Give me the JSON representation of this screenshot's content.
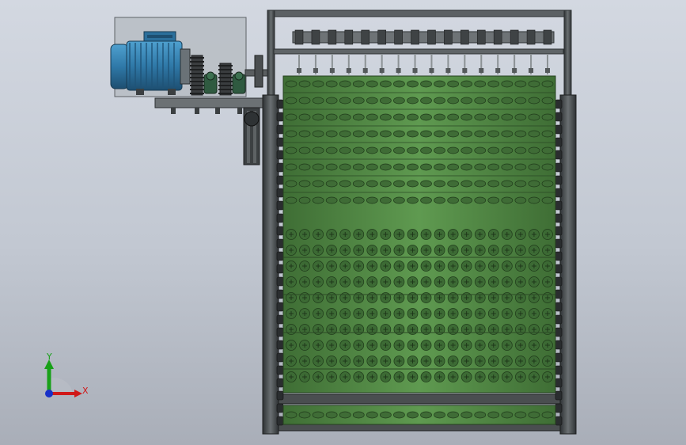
{
  "triad": {
    "x_label": "X",
    "y_label": "Y",
    "x_color": "#d01818",
    "y_color": "#18a018",
    "z_color": "#1830c8"
  },
  "model": {
    "motor_color": "#2f79a8",
    "conveyor_color": "#5b8f4e",
    "frame_color": "#4e5254",
    "housing_color": "#b4bbc1",
    "upper_hole_rows": 8,
    "lower_hole_rows": 10,
    "hole_columns": 20,
    "top_shaft_count": 16
  }
}
